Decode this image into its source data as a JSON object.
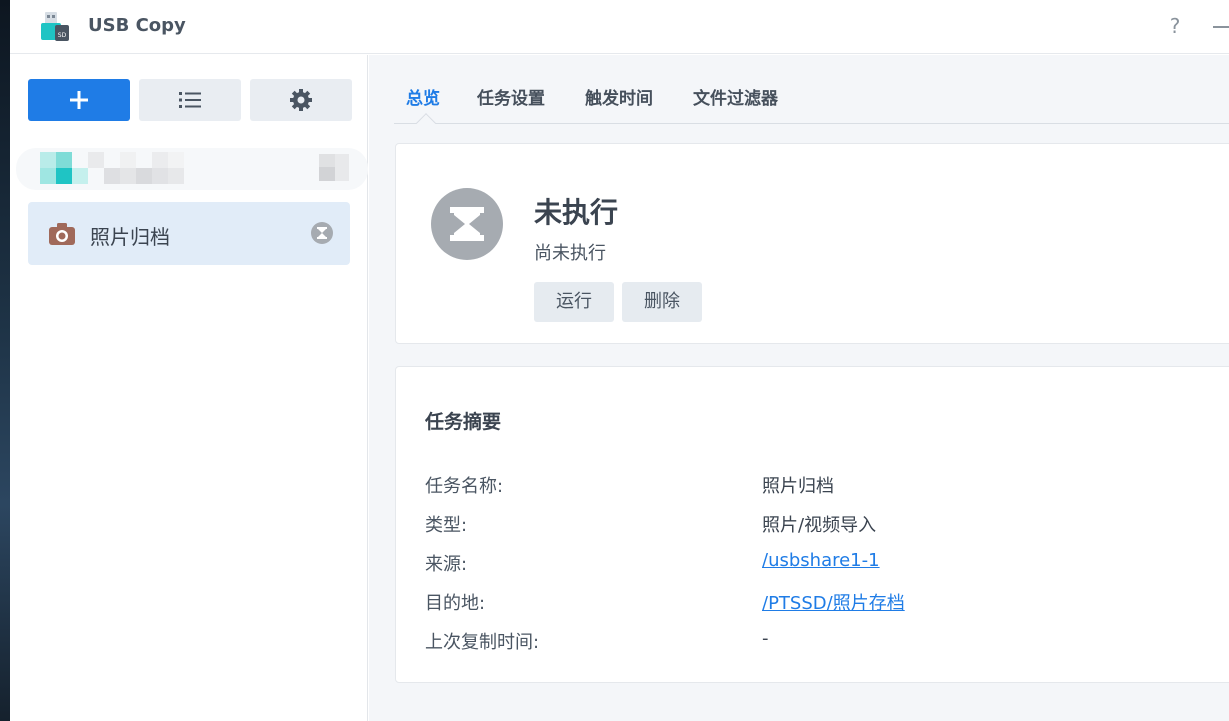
{
  "window": {
    "title": "USB Copy",
    "help_glyph": "?"
  },
  "sidebar": {
    "toolbar": {
      "add_icon": "plus-icon",
      "list_icon": "list-icon",
      "settings_icon": "gear-icon"
    },
    "tasks": [
      {
        "label": "照片归档",
        "icon": "camera-icon",
        "status_icon": "hourglass-icon",
        "selected": true
      }
    ]
  },
  "tabs": [
    {
      "label": "总览",
      "active": true
    },
    {
      "label": "任务设置",
      "active": false
    },
    {
      "label": "触发时间",
      "active": false
    },
    {
      "label": "文件过滤器",
      "active": false
    }
  ],
  "status": {
    "title": "未执行",
    "subtitle": "尚未执行",
    "icon": "hourglass-icon",
    "run_label": "运行",
    "delete_label": "删除"
  },
  "summary": {
    "title": "任务摘要",
    "rows": [
      {
        "label": "任务名称:",
        "value": "照片归档",
        "link": false
      },
      {
        "label": "类型:",
        "value": "照片/视频导入",
        "link": false
      },
      {
        "label": "来源:",
        "value": "/usbshare1-1",
        "link": true
      },
      {
        "label": "目的地:",
        "value": "/PTSSD/照片存档",
        "link": true
      },
      {
        "label": "上次复制时间:",
        "value": "-",
        "link": false
      }
    ]
  },
  "colors": {
    "accent": "#1f7ce6",
    "selected_bg": "#e1ecf8",
    "status_gray": "#a6abb1",
    "camera_brown": "#a0695a"
  }
}
